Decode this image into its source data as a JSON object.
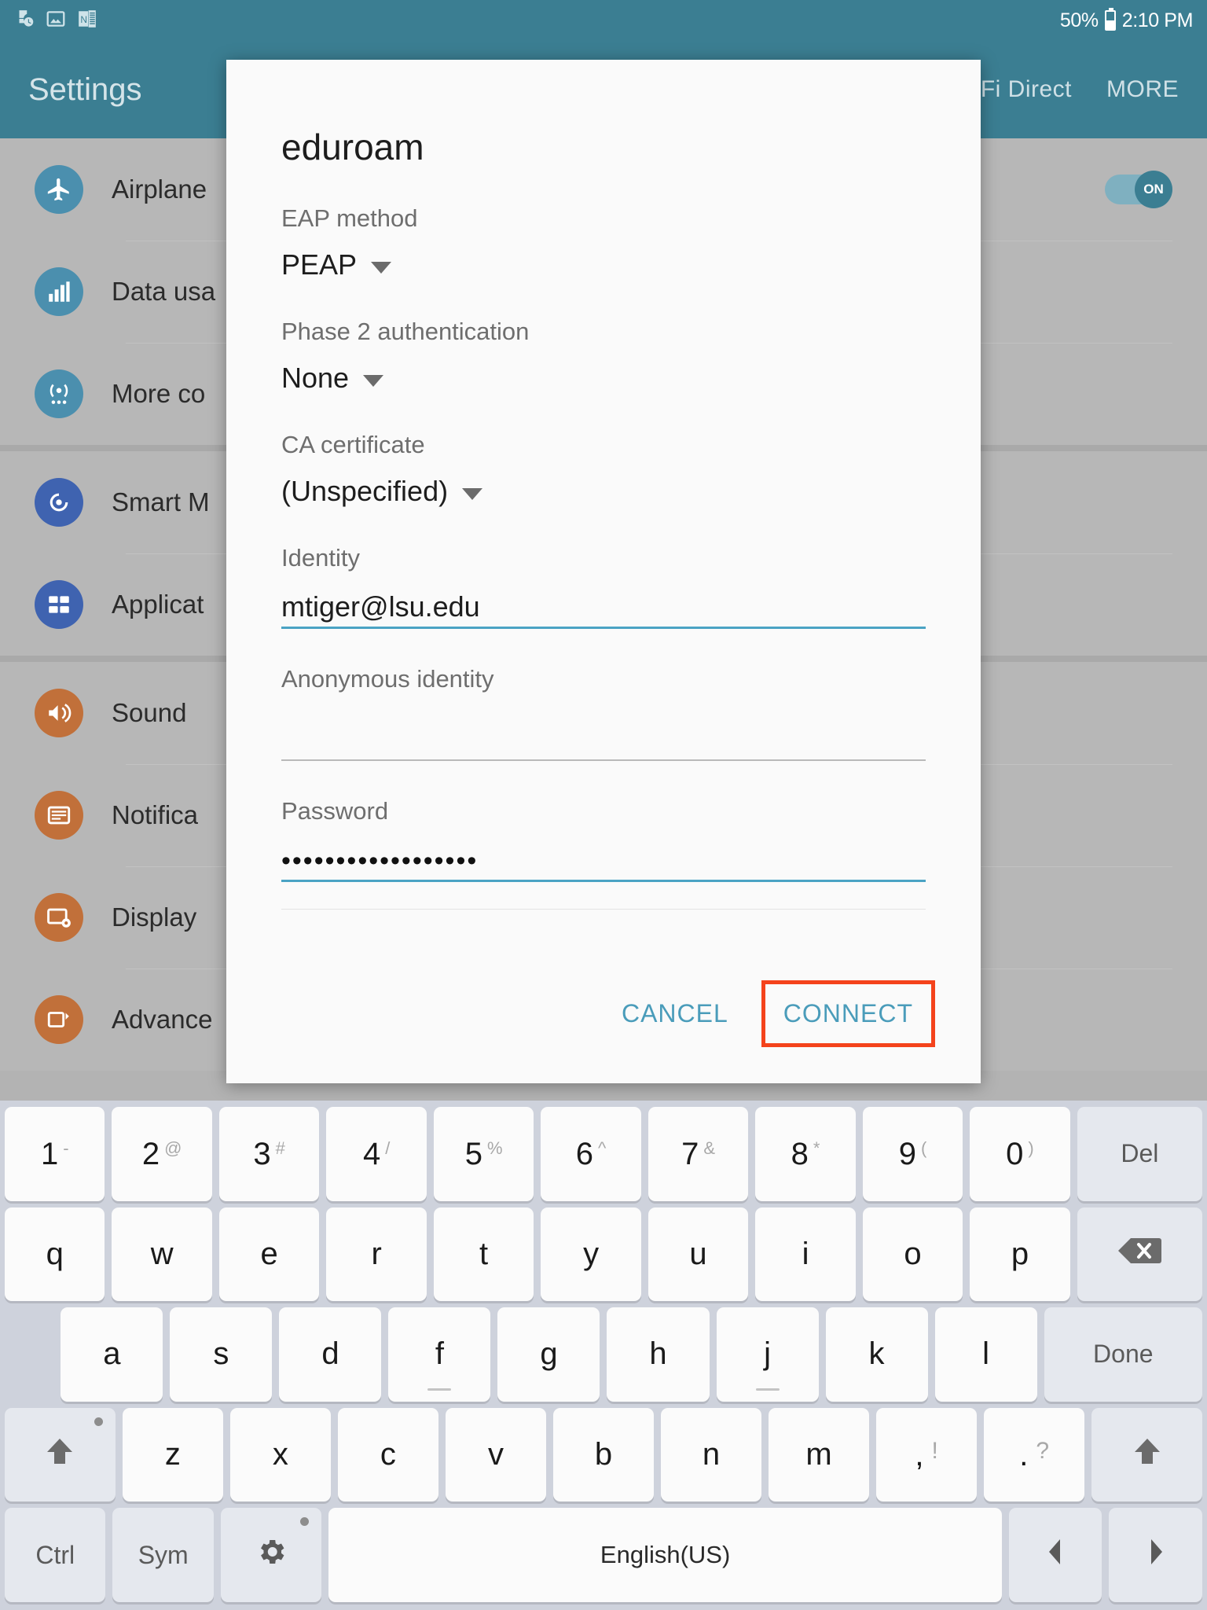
{
  "statusbar": {
    "icons": [
      "device-clock-icon",
      "image-icon",
      "onenote-icon"
    ],
    "battery_percent": "50%",
    "time": "2:10 PM"
  },
  "appbar": {
    "title": "Settings",
    "actions": [
      "Fi Direct",
      "MORE"
    ]
  },
  "settings_list": {
    "groups": [
      {
        "rows": [
          {
            "label": "Airplane",
            "icon": "airplane-icon",
            "color": "#4b8fae",
            "toggle": "ON"
          },
          {
            "label": "Data usa",
            "icon": "data-usage-icon",
            "color": "#4b8fae",
            "toggle": ""
          },
          {
            "label": "More co",
            "icon": "more-connections-icon",
            "color": "#4b8fae",
            "toggle": ""
          }
        ]
      },
      {
        "rows": [
          {
            "label": "Smart M",
            "icon": "smart-manager-icon",
            "color": "#3f63b0",
            "toggle": ""
          },
          {
            "label": "Applicat",
            "icon": "applications-icon",
            "color": "#3f63b0",
            "toggle": ""
          }
        ]
      },
      {
        "rows": [
          {
            "label": "Sound",
            "icon": "sound-icon",
            "color": "#c1703a",
            "toggle": ""
          },
          {
            "label": "Notifica",
            "icon": "notifications-icon",
            "color": "#c1703a",
            "toggle": ""
          },
          {
            "label": "Display",
            "icon": "display-icon",
            "color": "#c1703a",
            "toggle": ""
          },
          {
            "label": "Advance",
            "icon": "advanced-features-icon",
            "color": "#c1703a",
            "toggle": ""
          }
        ]
      }
    ]
  },
  "dialog": {
    "title": "eduroam",
    "eap_method": {
      "label": "EAP method",
      "value": "PEAP"
    },
    "phase2": {
      "label": "Phase 2 authentication",
      "value": "None"
    },
    "ca_certificate": {
      "label": "CA certificate",
      "value": "(Unspecified)"
    },
    "identity": {
      "label": "Identity",
      "value": "mtiger@lsu.edu",
      "placeholder": ""
    },
    "anonymous_identity": {
      "label": "Anonymous identity",
      "value": "",
      "placeholder": ""
    },
    "password": {
      "label": "Password",
      "value": "••••••••••••••••••",
      "placeholder": ""
    },
    "cancel_label": "CANCEL",
    "connect_label": "CONNECT",
    "highlight_color": "#f4431c",
    "accent_color": "#4a9cba"
  },
  "keyboard": {
    "row_numbers": [
      {
        "main": "1",
        "alt": "-"
      },
      {
        "main": "2",
        "alt": "@"
      },
      {
        "main": "3",
        "alt": "#"
      },
      {
        "main": "4",
        "alt": "/"
      },
      {
        "main": "5",
        "alt": "%"
      },
      {
        "main": "6",
        "alt": "^"
      },
      {
        "main": "7",
        "alt": "&"
      },
      {
        "main": "8",
        "alt": "*"
      },
      {
        "main": "9",
        "alt": "("
      },
      {
        "main": "0",
        "alt": ")"
      }
    ],
    "del_label": "Del",
    "row_top": [
      "q",
      "w",
      "e",
      "r",
      "t",
      "y",
      "u",
      "i",
      "o",
      "p"
    ],
    "backspace_icon": "backspace-icon",
    "row_home": [
      "a",
      "s",
      "d",
      "f",
      "g",
      "h",
      "j",
      "k",
      "l"
    ],
    "done_label": "Done",
    "row_bottom": [
      "z",
      "x",
      "c",
      "v",
      "b",
      "n",
      "m"
    ],
    "comma_key": {
      "main": ",",
      "alt": "!"
    },
    "period_key": {
      "main": ".",
      "alt": "?"
    },
    "shift_left_icon": "shift-icon",
    "shift_right_icon": "shift-icon",
    "ctrl_label": "Ctrl",
    "sym_label": "Sym",
    "settings_icon": "gear-icon",
    "space_label": "English(US)",
    "arrow_left_icon": "arrow-left-icon",
    "arrow_right_icon": "arrow-right-icon"
  }
}
